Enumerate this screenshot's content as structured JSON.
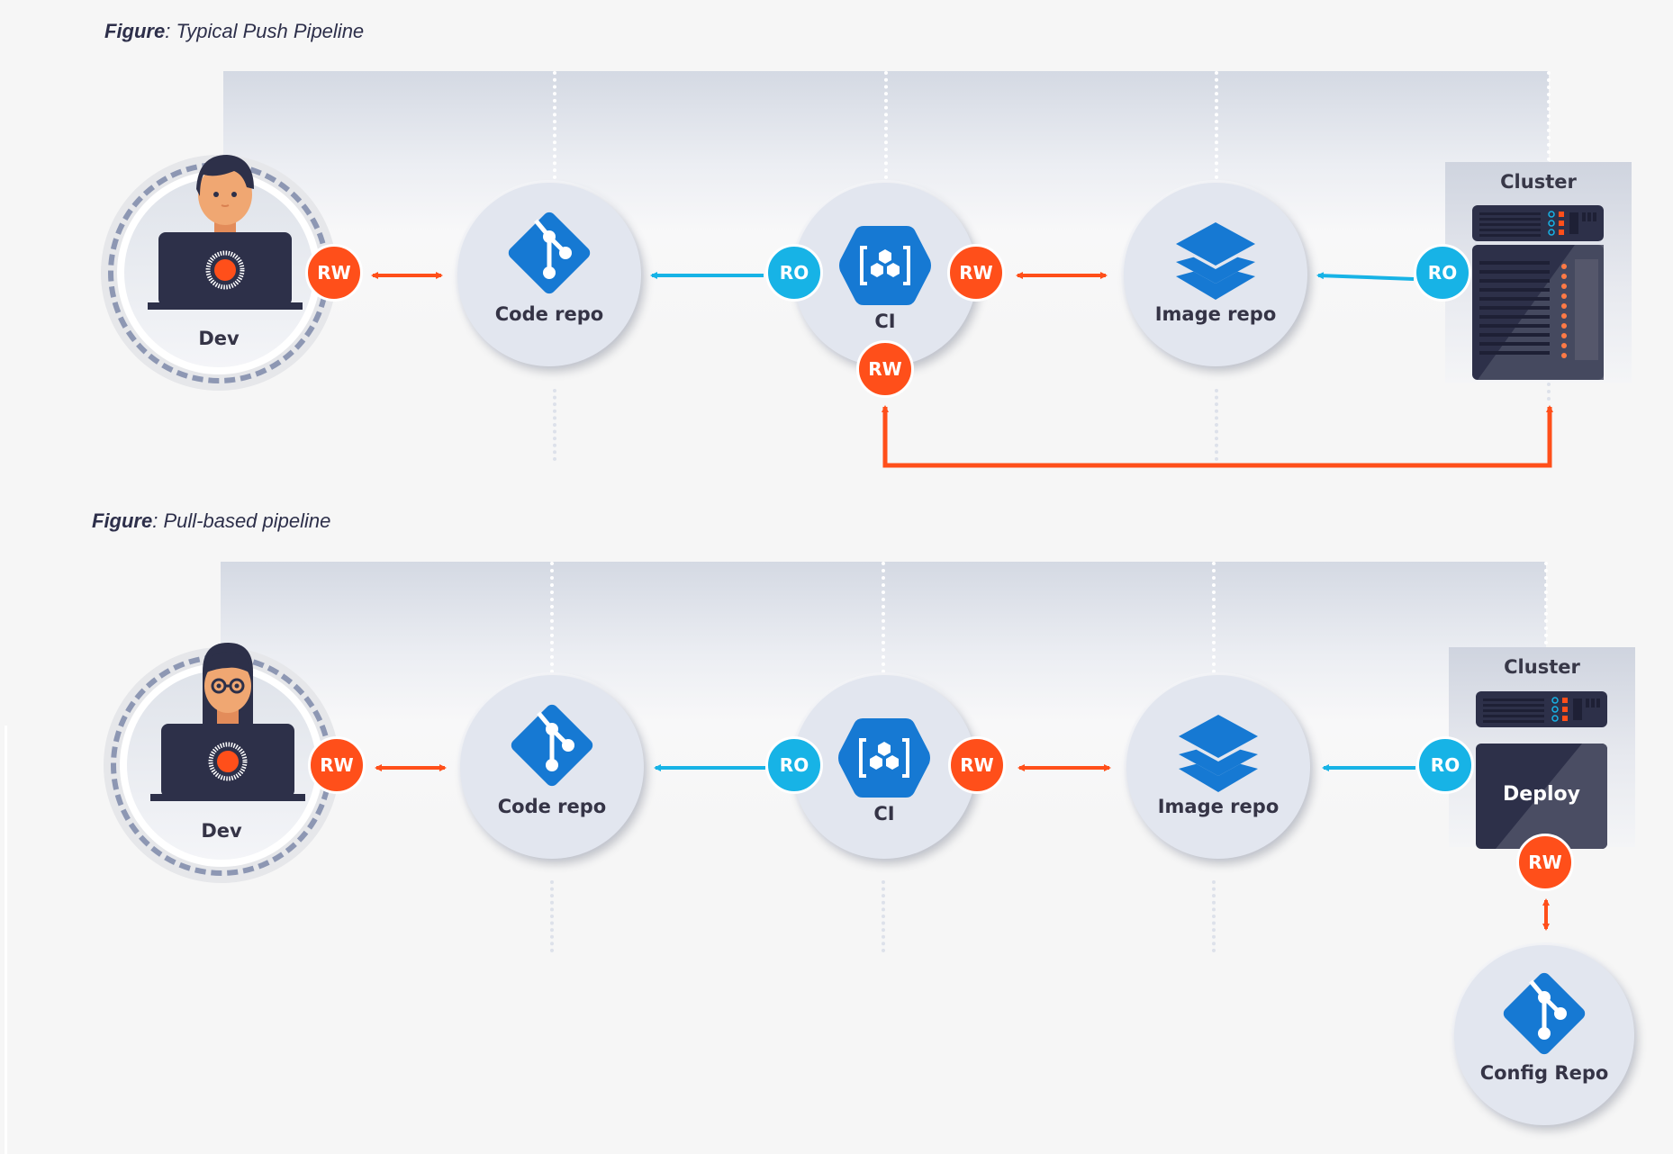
{
  "colors": {
    "rw": "#ff4f1a",
    "ro": "#17b3e6",
    "icon_blue": "#1679d3",
    "dark": "#2d3049",
    "node_bg": "#e2e6ef",
    "page_bg": "#f6f6f6"
  },
  "figures": [
    {
      "caption_prefix": "Figure",
      "caption_text": ": Typical Push Pipeline",
      "nodes": {
        "dev": {
          "label": "Dev",
          "icon": "developer-icon"
        },
        "code_repo": {
          "label": "Code repo",
          "icon": "git-icon"
        },
        "ci": {
          "label": "CI",
          "icon": "ci-hexagon-icon"
        },
        "image_repo": {
          "label": "Image repo",
          "icon": "layers-icon"
        },
        "cluster": {
          "label": "Cluster",
          "icon": "server-rack-icon"
        }
      },
      "badges": {
        "dev_right": "RW",
        "ci_left": "RO",
        "ci_right": "RW",
        "ci_bottom": "RW",
        "cluster_left": "RO"
      },
      "connections": [
        {
          "from": "dev",
          "to": "code_repo",
          "access": "RW",
          "direction": "bidirectional"
        },
        {
          "from": "ci",
          "to": "code_repo",
          "access": "RO",
          "direction": "to-code-repo"
        },
        {
          "from": "ci",
          "to": "image_repo",
          "access": "RW",
          "direction": "bidirectional"
        },
        {
          "from": "cluster",
          "to": "image_repo",
          "access": "RO",
          "direction": "to-image-repo"
        },
        {
          "from": "ci",
          "to": "cluster",
          "access": "RW",
          "direction": "bidirectional"
        }
      ]
    },
    {
      "caption_prefix": "Figure",
      "caption_text": ": Pull-based pipeline",
      "nodes": {
        "dev": {
          "label": "Dev",
          "icon": "developer-icon"
        },
        "code_repo": {
          "label": "Code repo",
          "icon": "git-icon"
        },
        "ci": {
          "label": "CI",
          "icon": "ci-hexagon-icon"
        },
        "image_repo": {
          "label": "Image repo",
          "icon": "layers-icon"
        },
        "cluster": {
          "label": "Cluster",
          "icon": "server-rack-icon"
        },
        "deploy": {
          "label": "Deploy"
        },
        "config_repo": {
          "label": "Config Repo",
          "icon": "git-icon"
        }
      },
      "badges": {
        "dev_right": "RW",
        "ci_left": "RO",
        "ci_right": "RW",
        "cluster_left": "RO",
        "deploy_bottom": "RW"
      },
      "connections": [
        {
          "from": "dev",
          "to": "code_repo",
          "access": "RW",
          "direction": "bidirectional"
        },
        {
          "from": "ci",
          "to": "code_repo",
          "access": "RO",
          "direction": "to-code-repo"
        },
        {
          "from": "ci",
          "to": "image_repo",
          "access": "RW",
          "direction": "bidirectional"
        },
        {
          "from": "cluster",
          "to": "image_repo",
          "access": "RO",
          "direction": "to-image-repo"
        },
        {
          "from": "deploy",
          "to": "config_repo",
          "access": "RW",
          "direction": "bidirectional"
        }
      ]
    }
  ]
}
